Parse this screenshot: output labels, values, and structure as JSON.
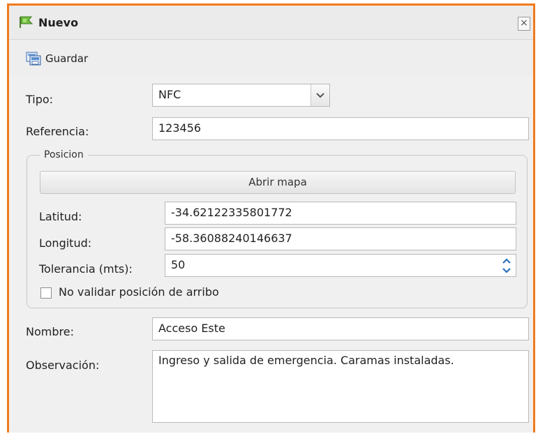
{
  "window": {
    "title": "Nuevo",
    "close_label": "×",
    "title_icon": "flag-icon"
  },
  "toolbar": {
    "save_label": "Guardar",
    "save_icon": "save-icon"
  },
  "form": {
    "tipo_label": "Tipo:",
    "tipo_value": "NFC",
    "referencia_label": "Referencia:",
    "referencia_value": "123456",
    "nombre_label": "Nombre:",
    "nombre_value": "Acceso Este",
    "observacion_label": "Observación:",
    "observacion_value": "Ingreso y salida de emergencia. Caramas instaladas."
  },
  "posicion": {
    "legend": "Posicion",
    "map_button_label": "Abrir mapa",
    "latitud_label": "Latitud:",
    "latitud_value": "-34.62122335801772",
    "longitud_label": "Longitud:",
    "longitud_value": "-58.36088240146637",
    "tolerancia_label": "Tolerancia (mts):",
    "tolerancia_value": "50",
    "no_validar_label": "No validar posición de arribo",
    "no_validar_checked": false
  },
  "colors": {
    "window_border": "#f07a1c",
    "spinner_arrow": "#2a6fb8"
  }
}
